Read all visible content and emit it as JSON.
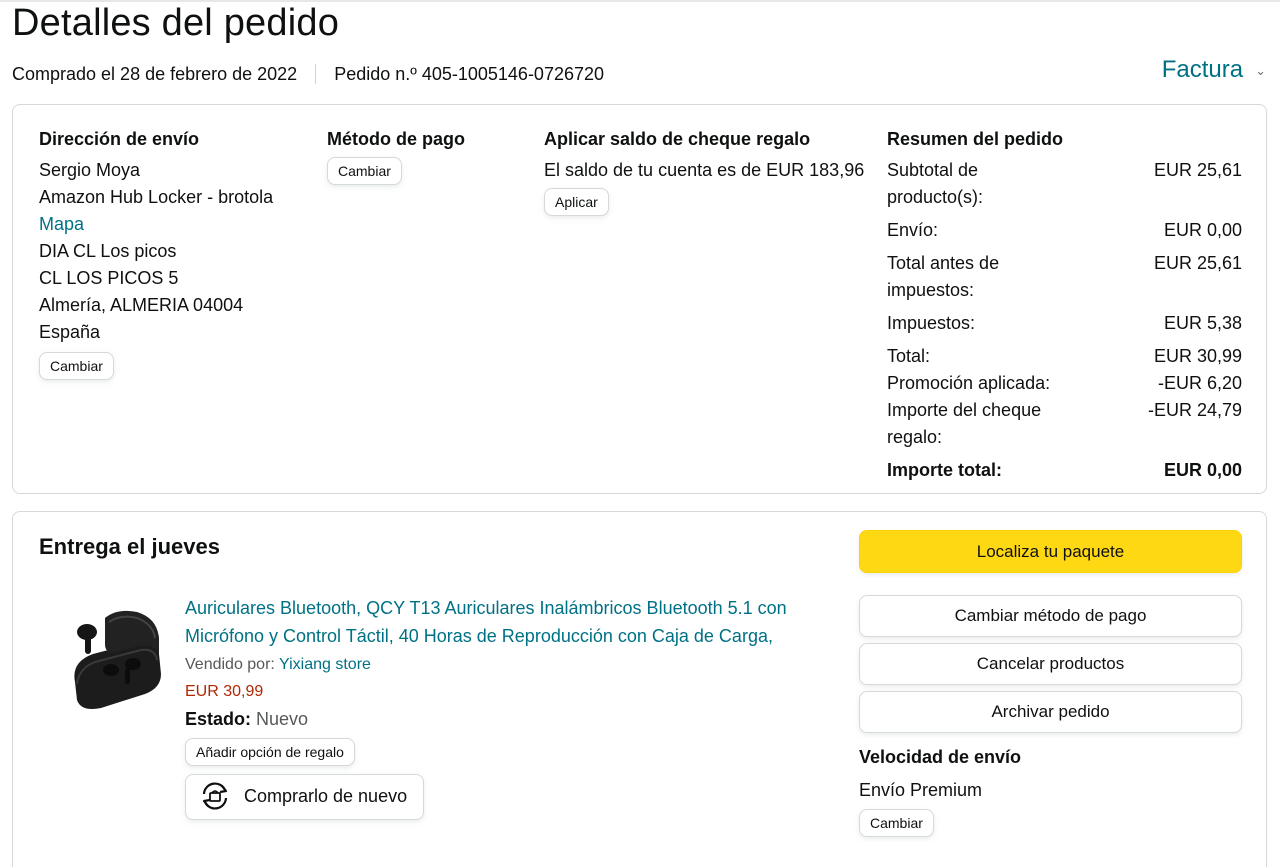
{
  "page": {
    "title": "Detalles del pedido",
    "purchased": "Comprado el 28 de febrero de 2022",
    "order_number": "Pedido n.º 405-1005146-0726720",
    "invoice_label": "Factura"
  },
  "shipping": {
    "heading": "Dirección de envío",
    "name": "Sergio Moya",
    "line1": "Amazon Hub Locker - brotola",
    "map_link": "Mapa",
    "line2": "DIA CL Los picos",
    "line3": "CL LOS PICOS 5",
    "line4": "Almería, ALMERIA 04004",
    "country": "España",
    "change_label": "Cambiar"
  },
  "payment": {
    "heading": "Método de pago",
    "change_label": "Cambiar"
  },
  "giftcard": {
    "heading": "Aplicar saldo de cheque regalo",
    "balance_text": "El saldo de tu cuenta es de EUR 183,96",
    "apply_label": "Aplicar"
  },
  "summary": {
    "heading": "Resumen del pedido",
    "rows": [
      {
        "label": "Subtotal de producto(s):",
        "value": "EUR 25,61"
      },
      {
        "label": "Envío:",
        "value": "EUR 0,00"
      },
      {
        "label": "Total antes de impuestos:",
        "value": "EUR 25,61"
      },
      {
        "label": "Impuestos:",
        "value": "EUR 5,38"
      },
      {
        "label": "Total:",
        "value": "EUR 30,99"
      },
      {
        "label": "Promoción aplicada:",
        "value": "-EUR 6,20"
      },
      {
        "label": "Importe del cheque regalo:",
        "value": "-EUR 24,79"
      }
    ],
    "grand_total_label": "Importe total:",
    "grand_total_value": "EUR 0,00"
  },
  "delivery": {
    "title": "Entrega el jueves",
    "product_title": "Auriculares Bluetooth, QCY T13 Auriculares Inalámbricos Bluetooth 5.1 con Micrófono y Control Táctil, 40 Horas de Reproducción con Caja de Carga,",
    "sold_by_label": "Vendido por:",
    "seller": "Yixiang store",
    "price": "EUR 30,99",
    "status_label": "Estado:",
    "status_value": "Nuevo",
    "gift_option_label": "Añadir opción de regalo",
    "buy_again_label": "Comprarlo de nuevo"
  },
  "actions": {
    "track": "Localiza tu paquete",
    "change_payment": "Cambiar método de pago",
    "cancel": "Cancelar productos",
    "archive": "Archivar pedido",
    "speed_heading": "Velocidad de envío",
    "speed_value": "Envío Premium",
    "speed_change": "Cambiar"
  },
  "colors": {
    "link": "#007185",
    "price": "#B12704",
    "primary_button": "#FFD814",
    "border": "#D5D9D9"
  }
}
